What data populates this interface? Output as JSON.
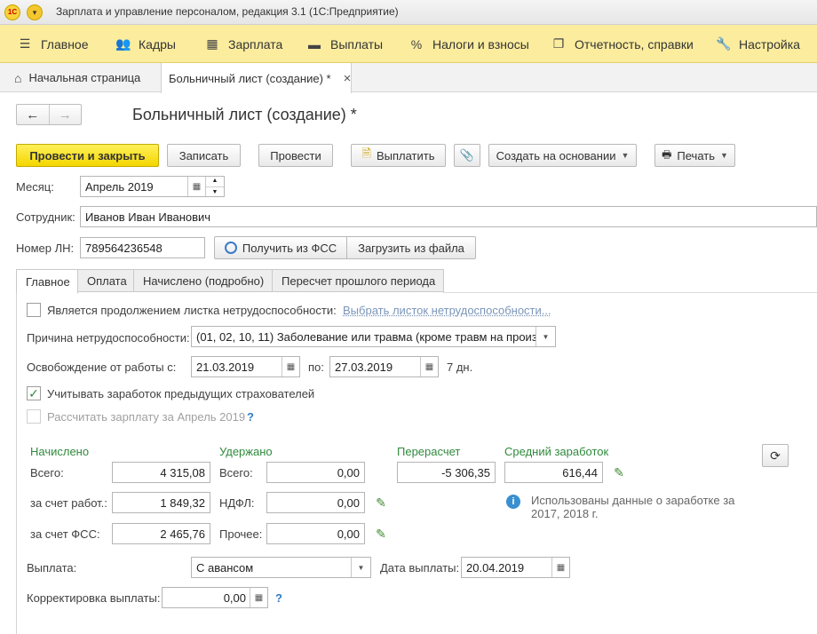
{
  "app": {
    "title": "Зарплата и управление персоналом, редакция 3.1  (1С:Предприятие)",
    "logo": "1С"
  },
  "menu": [
    {
      "icon": "☰",
      "label": "Главное"
    },
    {
      "icon": "👥",
      "label": "Кадры"
    },
    {
      "icon": "▦",
      "label": "Зарплата"
    },
    {
      "icon": "▬",
      "label": "Выплаты"
    },
    {
      "icon": "%",
      "label": "Налоги и взносы"
    },
    {
      "icon": "❐",
      "label": "Отчетность, справки"
    },
    {
      "icon": "🔧",
      "label": "Настройка"
    }
  ],
  "tabs": {
    "home": "Начальная страница",
    "doc": "Больничный лист (создание) *",
    "close": "×"
  },
  "doc": {
    "title": "Больничный лист (создание) *"
  },
  "toolbar": {
    "post_close": "Провести и закрыть",
    "save": "Записать",
    "post": "Провести",
    "pay": "Выплатить",
    "create_based": "Создать на основании",
    "print": "Печать"
  },
  "form": {
    "month_label": "Месяц:",
    "month_value": "Апрель 2019",
    "employee_label": "Сотрудник:",
    "employee_value": "Иванов Иван Иванович",
    "ln_label": "Номер ЛН:",
    "ln_value": "789564236548",
    "get_fss": "Получить из ФСС",
    "load_file": "Загрузить из файла"
  },
  "inner_tabs": [
    "Главное",
    "Оплата",
    "Начислено (подробно)",
    "Пересчет прошлого периода"
  ],
  "main": {
    "continuation_label": "Является продолжением листка нетрудоспособности:",
    "continuation_link": "Выбрать листок нетрудоспособности...",
    "reason_label": "Причина нетрудоспособности:",
    "reason_value": "(01, 02, 10, 11) Заболевание или травма (кроме травм на произв",
    "release_label": "Освобождение от работы с:",
    "date_from": "21.03.2019",
    "po_label": "по:",
    "date_to": "27.03.2019",
    "days": "7 дн.",
    "prev_insurers_label": "Учитывать заработок предыдущих страхователей",
    "calc_salary_label": "Рассчитать зарплату за Апрель 2019",
    "help": "?"
  },
  "totals": {
    "accrued_header": "Начислено",
    "withheld_header": "Удержано",
    "recalc_header": "Перерасчет",
    "avg_header": "Средний заработок",
    "total_label": "Всего:",
    "employer_label": "за счет работ.:",
    "fss_label": "за счет ФСС:",
    "withheld_total_label": "Всего:",
    "ndfl_label": "НДФЛ:",
    "other_label": "Прочее:",
    "accrued_total": "4 315,08",
    "accrued_employer": "1 849,32",
    "accrued_fss": "2 465,76",
    "withheld_total": "0,00",
    "withheld_ndfl": "0,00",
    "withheld_other": "0,00",
    "recalc_value": "-5 306,35",
    "avg_value": "616,44",
    "info_text_1": "Использованы данные о заработке за",
    "info_text_2": "2017,   2018 г."
  },
  "payment": {
    "payment_label": "Выплата:",
    "payment_value": "С авансом",
    "pay_date_label": "Дата выплаты:",
    "pay_date_value": "20.04.2019",
    "correction_label": "Корректировка выплаты:",
    "correction_value": "0,00"
  },
  "colors": {
    "menu_bg": "#fbec9e",
    "primary_button": "#f3d600",
    "section_header": "#2f8a3c",
    "link": "#7a95b9"
  }
}
